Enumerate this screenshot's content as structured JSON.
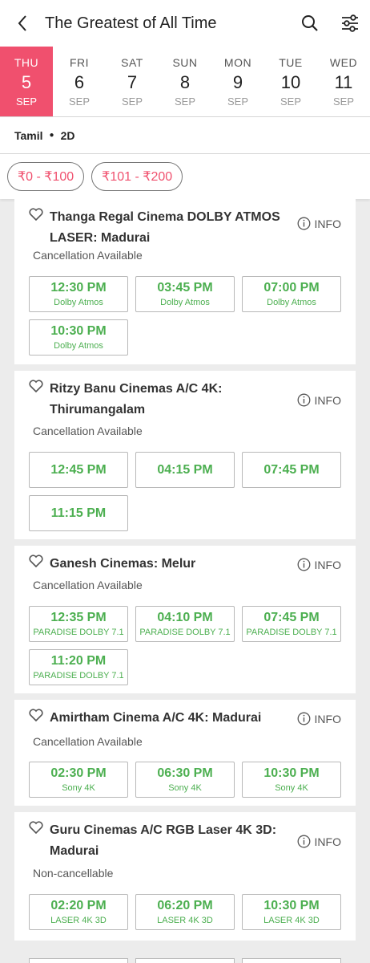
{
  "header": {
    "title": "The Greatest of All Time",
    "back_icon": "chevron-left-icon",
    "search_icon": "search-icon",
    "filter_icon": "sliders-icon"
  },
  "dates": [
    {
      "dow": "THU",
      "num": "5",
      "mon": "SEP",
      "active": true
    },
    {
      "dow": "FRI",
      "num": "6",
      "mon": "SEP"
    },
    {
      "dow": "SAT",
      "num": "7",
      "mon": "SEP"
    },
    {
      "dow": "SUN",
      "num": "8",
      "mon": "SEP"
    },
    {
      "dow": "MON",
      "num": "9",
      "mon": "SEP"
    },
    {
      "dow": "TUE",
      "num": "10",
      "mon": "SEP"
    },
    {
      "dow": "WED",
      "num": "11",
      "mon": "SEP"
    }
  ],
  "filters": {
    "language": "Tamil",
    "format": "2D"
  },
  "price_chips": [
    "₹0 - ₹100",
    "₹101 - ₹200"
  ],
  "info_label": "INFO",
  "cinemas": [
    {
      "name": "Thanga Regal Cinema DOLBY ATMOS LASER: Madurai",
      "cancellation": "Cancellation Available",
      "shows": [
        {
          "time": "12:30 PM",
          "format": "Dolby Atmos"
        },
        {
          "time": "03:45 PM",
          "format": "Dolby Atmos"
        },
        {
          "time": "07:00 PM",
          "format": "Dolby Atmos"
        },
        {
          "time": "10:30 PM",
          "format": "Dolby Atmos"
        }
      ]
    },
    {
      "name": "Ritzy Banu Cinemas A/C 4K: Thirumangalam",
      "cancellation": "Cancellation Available",
      "shows": [
        {
          "time": "12:45 PM",
          "format": ""
        },
        {
          "time": "04:15 PM",
          "format": ""
        },
        {
          "time": "07:45 PM",
          "format": ""
        },
        {
          "time": "11:15 PM",
          "format": ""
        }
      ]
    },
    {
      "name": "Ganesh Cinemas: Melur",
      "cancellation": "Cancellation Available",
      "shows": [
        {
          "time": "12:35 PM",
          "format": "PARADISE DOLBY 7.1"
        },
        {
          "time": "04:10 PM",
          "format": "PARADISE DOLBY 7.1"
        },
        {
          "time": "07:45 PM",
          "format": "PARADISE DOLBY 7.1"
        },
        {
          "time": "11:20 PM",
          "format": "PARADISE DOLBY 7.1"
        }
      ]
    },
    {
      "name": "Amirtham Cinema A/C 4K: Madurai",
      "cancellation": "Cancellation Available",
      "shows": [
        {
          "time": "02:30 PM",
          "format": "Sony 4K"
        },
        {
          "time": "06:30 PM",
          "format": "Sony 4K"
        },
        {
          "time": "10:30 PM",
          "format": "Sony 4K"
        }
      ]
    },
    {
      "name": "Guru Cinemas A/C RGB Laser 4K 3D: Madurai",
      "cancellation": "Non-cancellable",
      "shows": [
        {
          "time": "02:20 PM",
          "format": "LASER 4K 3D"
        },
        {
          "time": "06:20 PM",
          "format": "LASER 4K 3D"
        },
        {
          "time": "10:30 PM",
          "format": "LASER 4K 3D"
        }
      ]
    }
  ],
  "colors": {
    "accent": "#f0506e",
    "showtime": "#4caf50"
  }
}
